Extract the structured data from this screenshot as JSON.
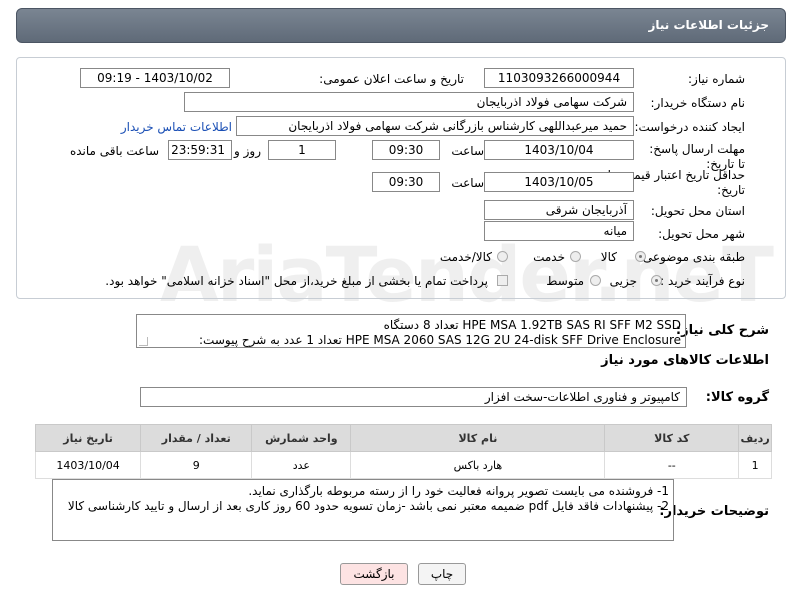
{
  "header": {
    "title": "جزئیات اطلاعات نیاز"
  },
  "form": {
    "need_number_label": "شماره نیاز:",
    "need_number": "1103093266000944",
    "announce_label": "تاریخ و ساعت اعلان عمومی:",
    "announce_value": "1403/10/02 - 09:19",
    "buyer_label": "نام دستگاه خریدار:",
    "buyer_value": "شرکت سهامی فولاد اذربایجان",
    "creator_label": "ایجاد کننده درخواست:",
    "creator_value": "حمید میرعبداللهی کارشناس بازرگانی شرکت سهامی فولاد اذربایجان",
    "contact_link": "اطلاعات تماس خریدار",
    "deadline_label": "مهلت ارسال پاسخ: تا تاریخ:",
    "deadline_date": "1403/10/04",
    "time_label": "ساعت",
    "deadline_time": "09:30",
    "days_value": "1",
    "days_label": "روز و",
    "remaining_time": "23:59:31",
    "remaining_label": "ساعت باقی مانده",
    "validity_label": "حداقل تاریخ اعتبار قیمت: تا تاریخ:",
    "validity_date": "1403/10/05",
    "validity_time": "09:30",
    "province_label": "استان محل تحویل:",
    "province_value": "آذربایجان شرقی",
    "city_label": "شهر محل تحویل:",
    "city_value": "میانه",
    "category_label": "طبقه بندی موضوعی:",
    "category_options": [
      "کالا",
      "خدمت",
      "کالا/خدمت"
    ],
    "category_selected": "کالا",
    "process_label": "نوع فرآیند خرید :",
    "process_options": [
      "جزیی",
      "متوسط"
    ],
    "process_selected": "جزیی",
    "payment_note": "پرداخت تمام یا بخشی از مبلغ خرید،از محل \"اسناد خزانه اسلامی\" خواهد بود."
  },
  "description": {
    "label": "شرح کلی نیاز:",
    "line1": "HPE MSA 1.92TB SAS RI SFF M2 SSD تعداد 8 دستگاه",
    "line2": "HPE MSA 2060 SAS 12G 2U 24-disk SFF Drive Enclosure تعداد 1 عدد به شرح پیوست:"
  },
  "goods_section": {
    "title": "اطلاعات کالاهای مورد نیاز",
    "group_label": "گروه کالا:",
    "group_value": "کامپیوتر و فناوری اطلاعات-سخت افزار"
  },
  "table": {
    "headers": [
      "ردیف",
      "کد کالا",
      "نام کالا",
      "واحد شمارش",
      "تعداد / مقدار",
      "تاریخ نیاز"
    ],
    "rows": [
      [
        "1",
        "--",
        "هارد باکس",
        "عدد",
        "9",
        "1403/10/04"
      ]
    ]
  },
  "buyer_notes": {
    "label": "توضیحات خریدار:",
    "line1": "1- فروشنده می بایست تصویر پروانه فعالیت خود را از رسته مربوطه بارگذاری نماید.",
    "line2": "2- پیشنهادات فاقد فایل pdf  ضمیمه معتبر نمی باشد -زمان تسویه حدود 60  روز کاری بعد از ارسال و تایید کارشناسی کالا"
  },
  "buttons": {
    "print": "چاپ",
    "back": "بازگشت"
  },
  "watermark": "AriaTender.neT",
  "colors": {
    "header_bg": "#6b7684",
    "link": "#1a4fb5",
    "back_button_bg": "#fde3e3"
  }
}
